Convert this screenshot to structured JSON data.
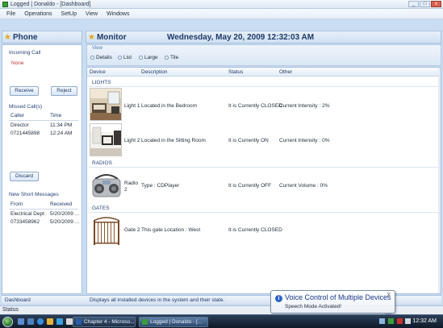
{
  "window": {
    "title": "Logged | Donaldo - [Dashboard]",
    "btn_min": "_",
    "btn_max": "□",
    "btn_close": "x"
  },
  "menu": [
    "File",
    "Operations",
    "SetUp",
    "View",
    "Windows"
  ],
  "phone": {
    "title": "Phone",
    "incoming_title": "Incoming Call",
    "incoming_value": "None",
    "receive": "Receive",
    "reject": "Reject",
    "missed_title": "Missed Call(s)",
    "missed_cols": [
      "Caller",
      "Time"
    ],
    "missed_rows": [
      [
        "Director",
        "11:34 PM"
      ],
      [
        "0721445898",
        "12:24 AM"
      ]
    ],
    "discard": "Discard",
    "sms_title": "New Short Messages",
    "sms_cols": [
      "From",
      "Received"
    ],
    "sms_rows": [
      [
        "Electrical Dept",
        "5/20/2009 ..."
      ],
      [
        "0733458962",
        "5/20/2009 ..."
      ]
    ]
  },
  "monitor": {
    "title": "Monitor",
    "datetime": "Wednesday, May 20, 2009 12:32:03 AM",
    "view_label": "View",
    "view_options": [
      "Details",
      "List",
      "Large",
      "Tile"
    ],
    "columns": [
      "Device",
      "Description",
      "Status",
      "Other"
    ],
    "groups": [
      {
        "name": "LIGHTS",
        "items": [
          {
            "device": "Light 1",
            "description": "Located in the Bedroom",
            "status": "It is Currently CLOSED",
            "other": "Current Intensity : 2%"
          },
          {
            "device": "Light 2",
            "description": "Located in the Sitting Room",
            "status": "It is Currently ON",
            "other": "Current Intensity : 0%"
          }
        ]
      },
      {
        "name": "RADIOS",
        "items": [
          {
            "device": "Radio 2",
            "description": "Type : CDPlayer",
            "status": "It is Currently OFF",
            "other": "Current Volume : 0%"
          }
        ]
      },
      {
        "name": "GATES",
        "items": [
          {
            "device": "Gate 2",
            "description": "This gate Location : West",
            "status": "It is Currently CLOSED",
            "other": ""
          }
        ]
      }
    ]
  },
  "footer": {
    "left": "Dashboard",
    "right": "Displays all  installed devices in the system and their state."
  },
  "statusbar": "Status",
  "taskbar": {
    "tasks": [
      "Chapter 4 - Microso...",
      "Logged | Donaldo - [..."
    ],
    "clock": "12:32 AM"
  },
  "balloon": {
    "icon": "i",
    "title": "Voice Control of Multiple Devices",
    "subtitle": "Speech Mode Activated!",
    "close": "X"
  }
}
